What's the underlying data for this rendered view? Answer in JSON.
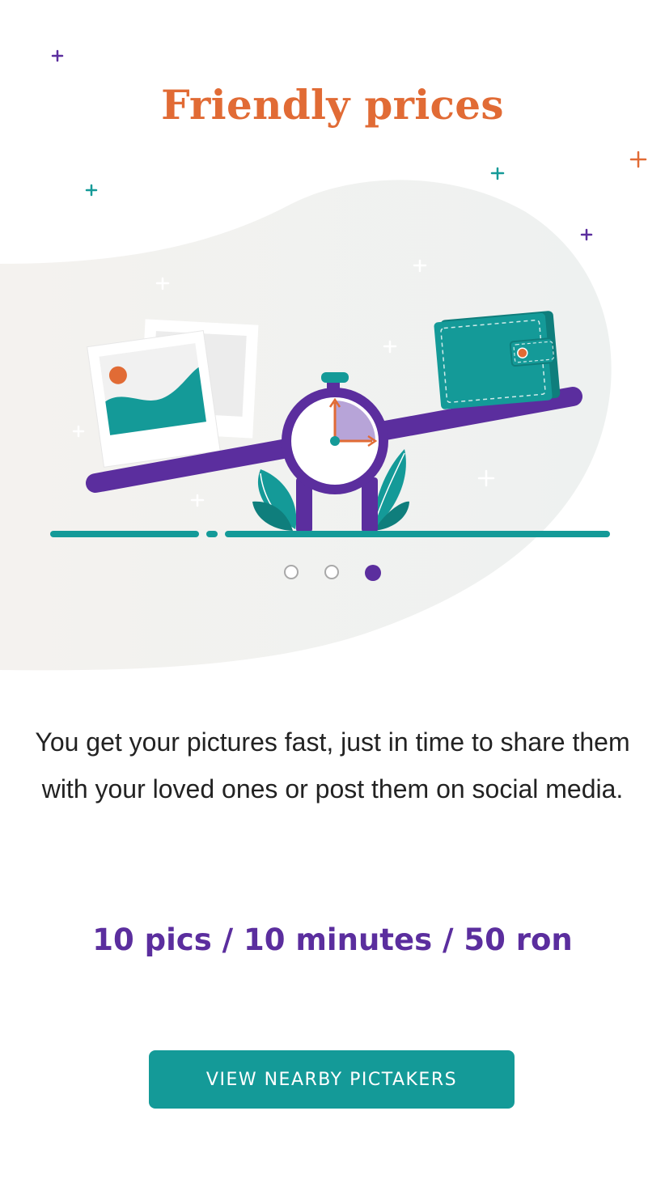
{
  "screen": {
    "title": "Friendly prices",
    "description": "You get your pictures fast, just in time to share them with your loved ones or post them on social media.",
    "price_line": "10 pics / 10 minutes / 50 ron",
    "cta_label": "VIEW NEARBY PICTAKERS"
  },
  "carousel": {
    "total_pages": 3,
    "active_page": 3
  },
  "illustration": {
    "icons": [
      "photo-frame-icon",
      "stopwatch-icon",
      "wallet-icon",
      "leaf-icon",
      "sparkle-icon"
    ]
  },
  "colors": {
    "title": "#e16b35",
    "accent_purple": "#5b2e9e",
    "accent_teal": "#149a98",
    "accent_orange": "#e16b35",
    "blob": "#f1f1ef",
    "body_text": "#222222"
  }
}
